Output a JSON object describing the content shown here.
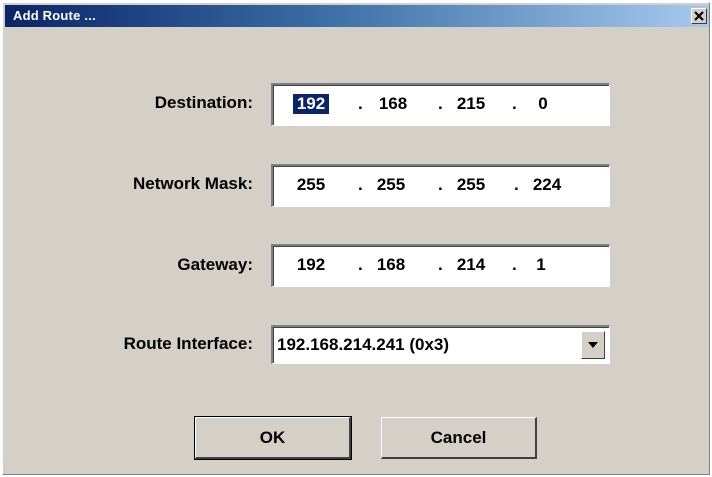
{
  "dialog": {
    "title": "Add Route ...",
    "close_icon": "close-x-icon"
  },
  "fields": {
    "destination": {
      "label": "Destination:",
      "octets": [
        "192",
        "168",
        "215",
        "0"
      ]
    },
    "network_mask": {
      "label": "Network Mask:",
      "octets": [
        "255",
        "255",
        "255",
        "224"
      ]
    },
    "gateway": {
      "label": "Gateway:",
      "octets": [
        "192",
        "168",
        "214",
        "1"
      ]
    },
    "route_interface": {
      "label": "Route Interface:",
      "value": "192.168.214.241 (0x3)"
    }
  },
  "buttons": {
    "ok": "OK",
    "cancel": "Cancel"
  },
  "colors": {
    "titlebar_start": "#0a246a",
    "titlebar_end": "#a6caf0",
    "dialog_bg": "#d4d0c8",
    "selection": "#0a246a"
  }
}
